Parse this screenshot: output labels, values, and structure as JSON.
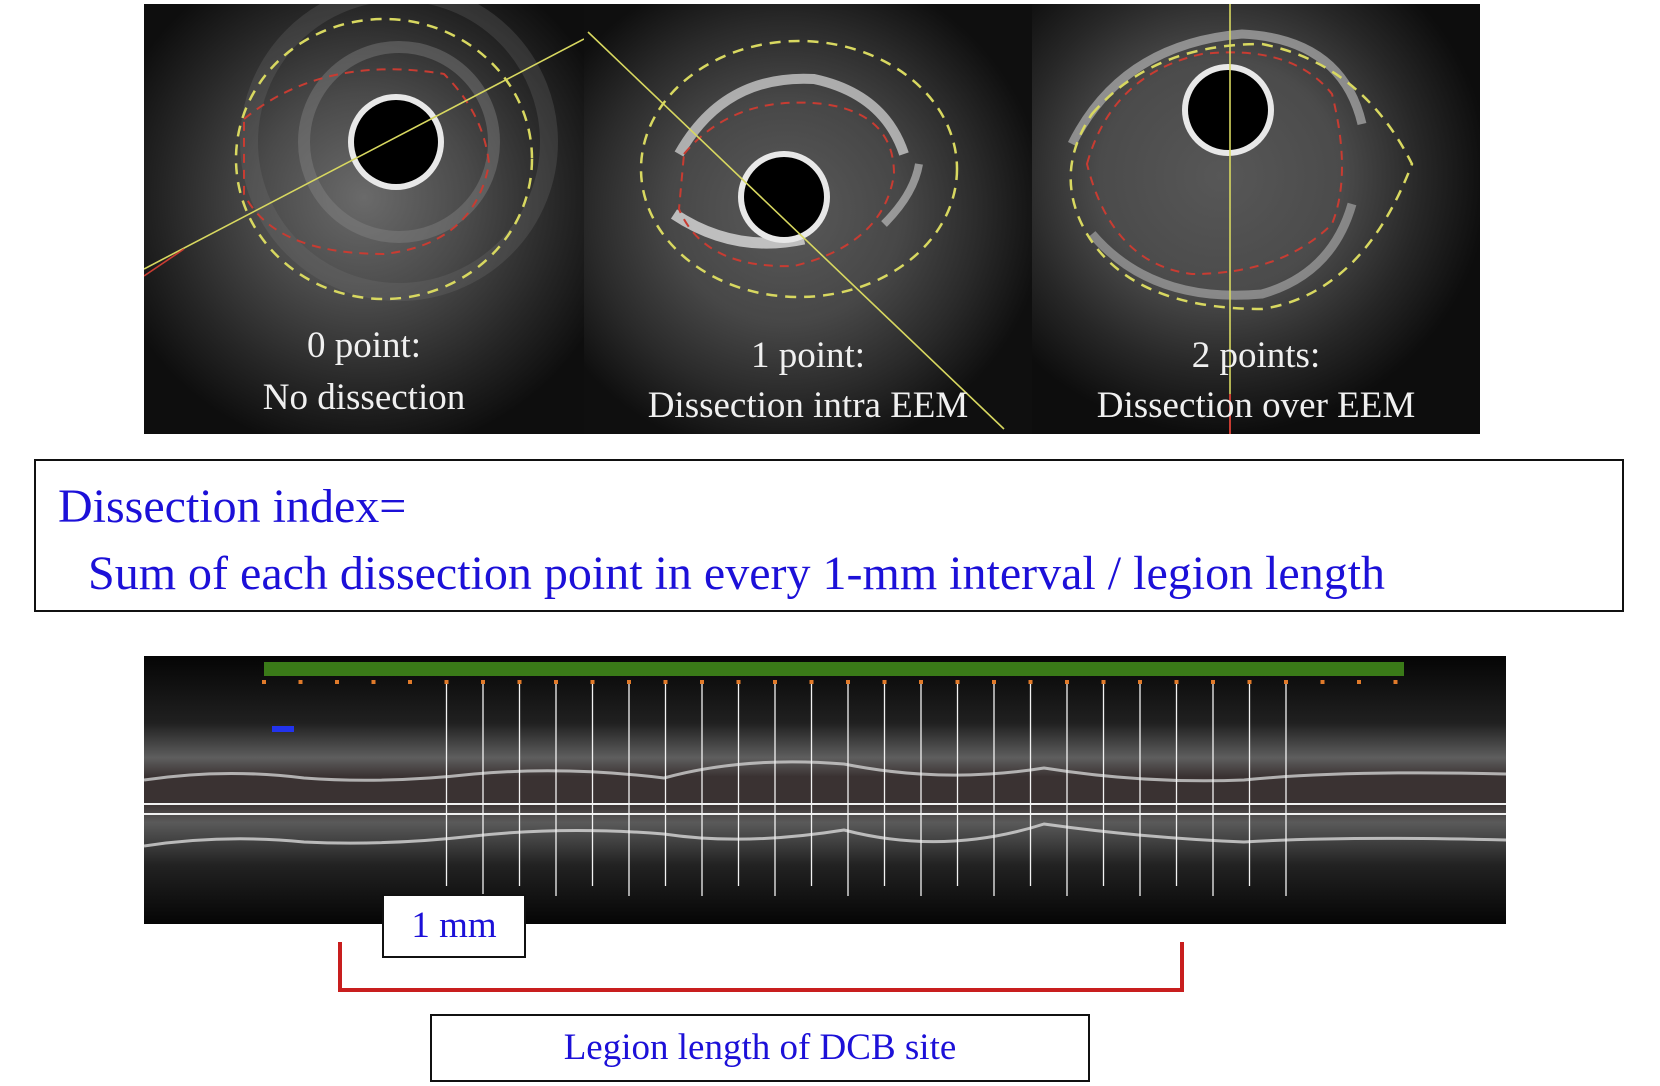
{
  "panels": [
    {
      "line1": "0 point:",
      "line2": "No dissection"
    },
    {
      "line1": "1 point:",
      "line2": "Dissection intra EEM"
    },
    {
      "line1": "2 points:",
      "line2": "Dissection over EEM"
    }
  ],
  "formula": {
    "line1": "Dissection index=",
    "line2": "Sum of each dissection point in every 1-mm interval / legion length"
  },
  "longitudinal": {
    "scale_label": "1 mm",
    "lesion_label": "Legion length of DCB site"
  },
  "colors": {
    "label_blue": "#1c10d8",
    "eem_contour": "#d8d860",
    "lumen_contour": "#c83c32",
    "bracket_red": "#c81e1e",
    "marker_green": "#3a7a18"
  }
}
